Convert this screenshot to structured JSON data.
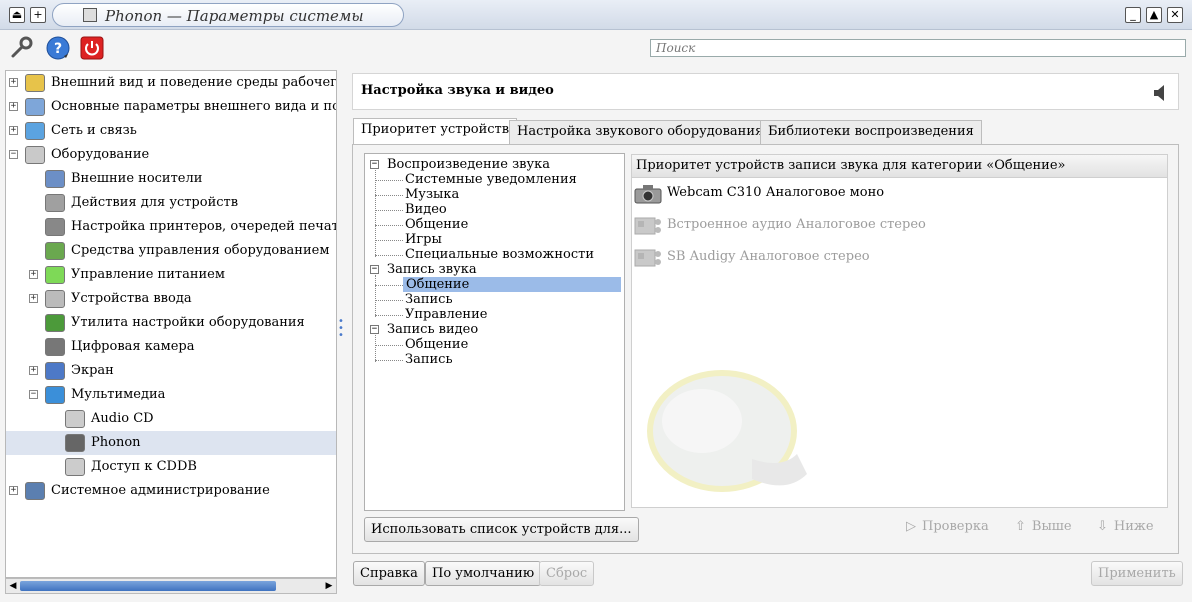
{
  "window": {
    "title": "Phonon — Параметры системы"
  },
  "toolbar": {
    "search_placeholder": "Поиск",
    "icons": [
      "wrench-icon",
      "help-icon",
      "power-icon"
    ]
  },
  "sidebar": {
    "items": [
      {
        "label": "Внешний вид и поведение среды рабочего стола",
        "level": 0,
        "expander": "+",
        "icon": "appearance-icon"
      },
      {
        "label": "Основные параметры внешнего вида и поведения",
        "level": 0,
        "expander": "+",
        "icon": "appearance-icon"
      },
      {
        "label": "Сеть и связь",
        "level": 0,
        "expander": "+",
        "icon": "network-icon"
      },
      {
        "label": "Оборудование",
        "level": 0,
        "expander": "−",
        "icon": "hardware-icon"
      },
      {
        "label": "Внешние носители",
        "level": 1,
        "expander": "",
        "icon": "usb-icon"
      },
      {
        "label": "Действия для устройств",
        "level": 1,
        "expander": "",
        "icon": "gears-icon"
      },
      {
        "label": "Настройка принтеров, очередей печати",
        "level": 1,
        "expander": "",
        "icon": "printer-icon"
      },
      {
        "label": "Средства управления оборудованием",
        "level": 1,
        "expander": "",
        "icon": "chip-icon"
      },
      {
        "label": "Управление питанием",
        "level": 1,
        "expander": "+",
        "icon": "battery-icon"
      },
      {
        "label": "Устройства ввода",
        "level": 1,
        "expander": "+",
        "icon": "keyboard-icon"
      },
      {
        "label": "Утилита настройки оборудования",
        "level": 1,
        "expander": "",
        "icon": "board-info-icon"
      },
      {
        "label": "Цифровая камера",
        "level": 1,
        "expander": "",
        "icon": "camera-icon"
      },
      {
        "label": "Экран",
        "level": 1,
        "expander": "+",
        "icon": "monitor-icon"
      },
      {
        "label": "Мультимедиа",
        "level": 1,
        "expander": "−",
        "icon": "headphones-icon"
      },
      {
        "label": "Audio CD",
        "level": 2,
        "expander": "",
        "icon": "cd-icon"
      },
      {
        "label": "Phonon",
        "level": 2,
        "expander": "",
        "icon": "speaker-icon",
        "selected": true
      },
      {
        "label": "Доступ к CDDB",
        "level": 2,
        "expander": "",
        "icon": "cd-icon"
      },
      {
        "label": "Системное администрирование",
        "level": 0,
        "expander": "+",
        "icon": "admin-icon"
      }
    ]
  },
  "header": {
    "title": "Настройка звука и видео"
  },
  "tabs": [
    {
      "label": "Приоритет устройств",
      "active": true
    },
    {
      "label": "Настройка звукового оборудования",
      "active": false
    },
    {
      "label": "Библиотеки воспроизведения",
      "active": false
    }
  ],
  "categories": [
    {
      "label": "Воспроизведение звука",
      "level": 0,
      "expander": "−"
    },
    {
      "label": "Системные уведомления",
      "level": 1
    },
    {
      "label": "Музыка",
      "level": 1
    },
    {
      "label": "Видео",
      "level": 1
    },
    {
      "label": "Общение",
      "level": 1
    },
    {
      "label": "Игры",
      "level": 1
    },
    {
      "label": "Специальные возможности",
      "level": 1
    },
    {
      "label": "Запись звука",
      "level": 0,
      "expander": "−"
    },
    {
      "label": "Общение",
      "level": 1,
      "selected": true
    },
    {
      "label": "Запись",
      "level": 1
    },
    {
      "label": "Управление",
      "level": 1
    },
    {
      "label": "Запись видео",
      "level": 0,
      "expander": "−"
    },
    {
      "label": "Общение",
      "level": 1
    },
    {
      "label": "Запись",
      "level": 1
    }
  ],
  "use_list_button": "Использовать список устройств для...",
  "devices": {
    "header": "Приоритет устройств записи звука для категории «Общение»",
    "items": [
      {
        "label": "Webcam C310 Аналоговое моно",
        "enabled": true,
        "icon": "webcam-icon"
      },
      {
        "label": "Встроенное аудио Аналоговое стерео",
        "enabled": false,
        "icon": "audio-card-icon"
      },
      {
        "label": "SB Audigy Аналоговое стерео",
        "enabled": false,
        "icon": "audio-card-icon"
      }
    ]
  },
  "device_actions": {
    "test": "Проверка",
    "up": "Выше",
    "down": "Ниже"
  },
  "footer": {
    "help": "Справка",
    "defaults": "По умолчанию",
    "reset": "Сброс",
    "apply": "Применить"
  }
}
